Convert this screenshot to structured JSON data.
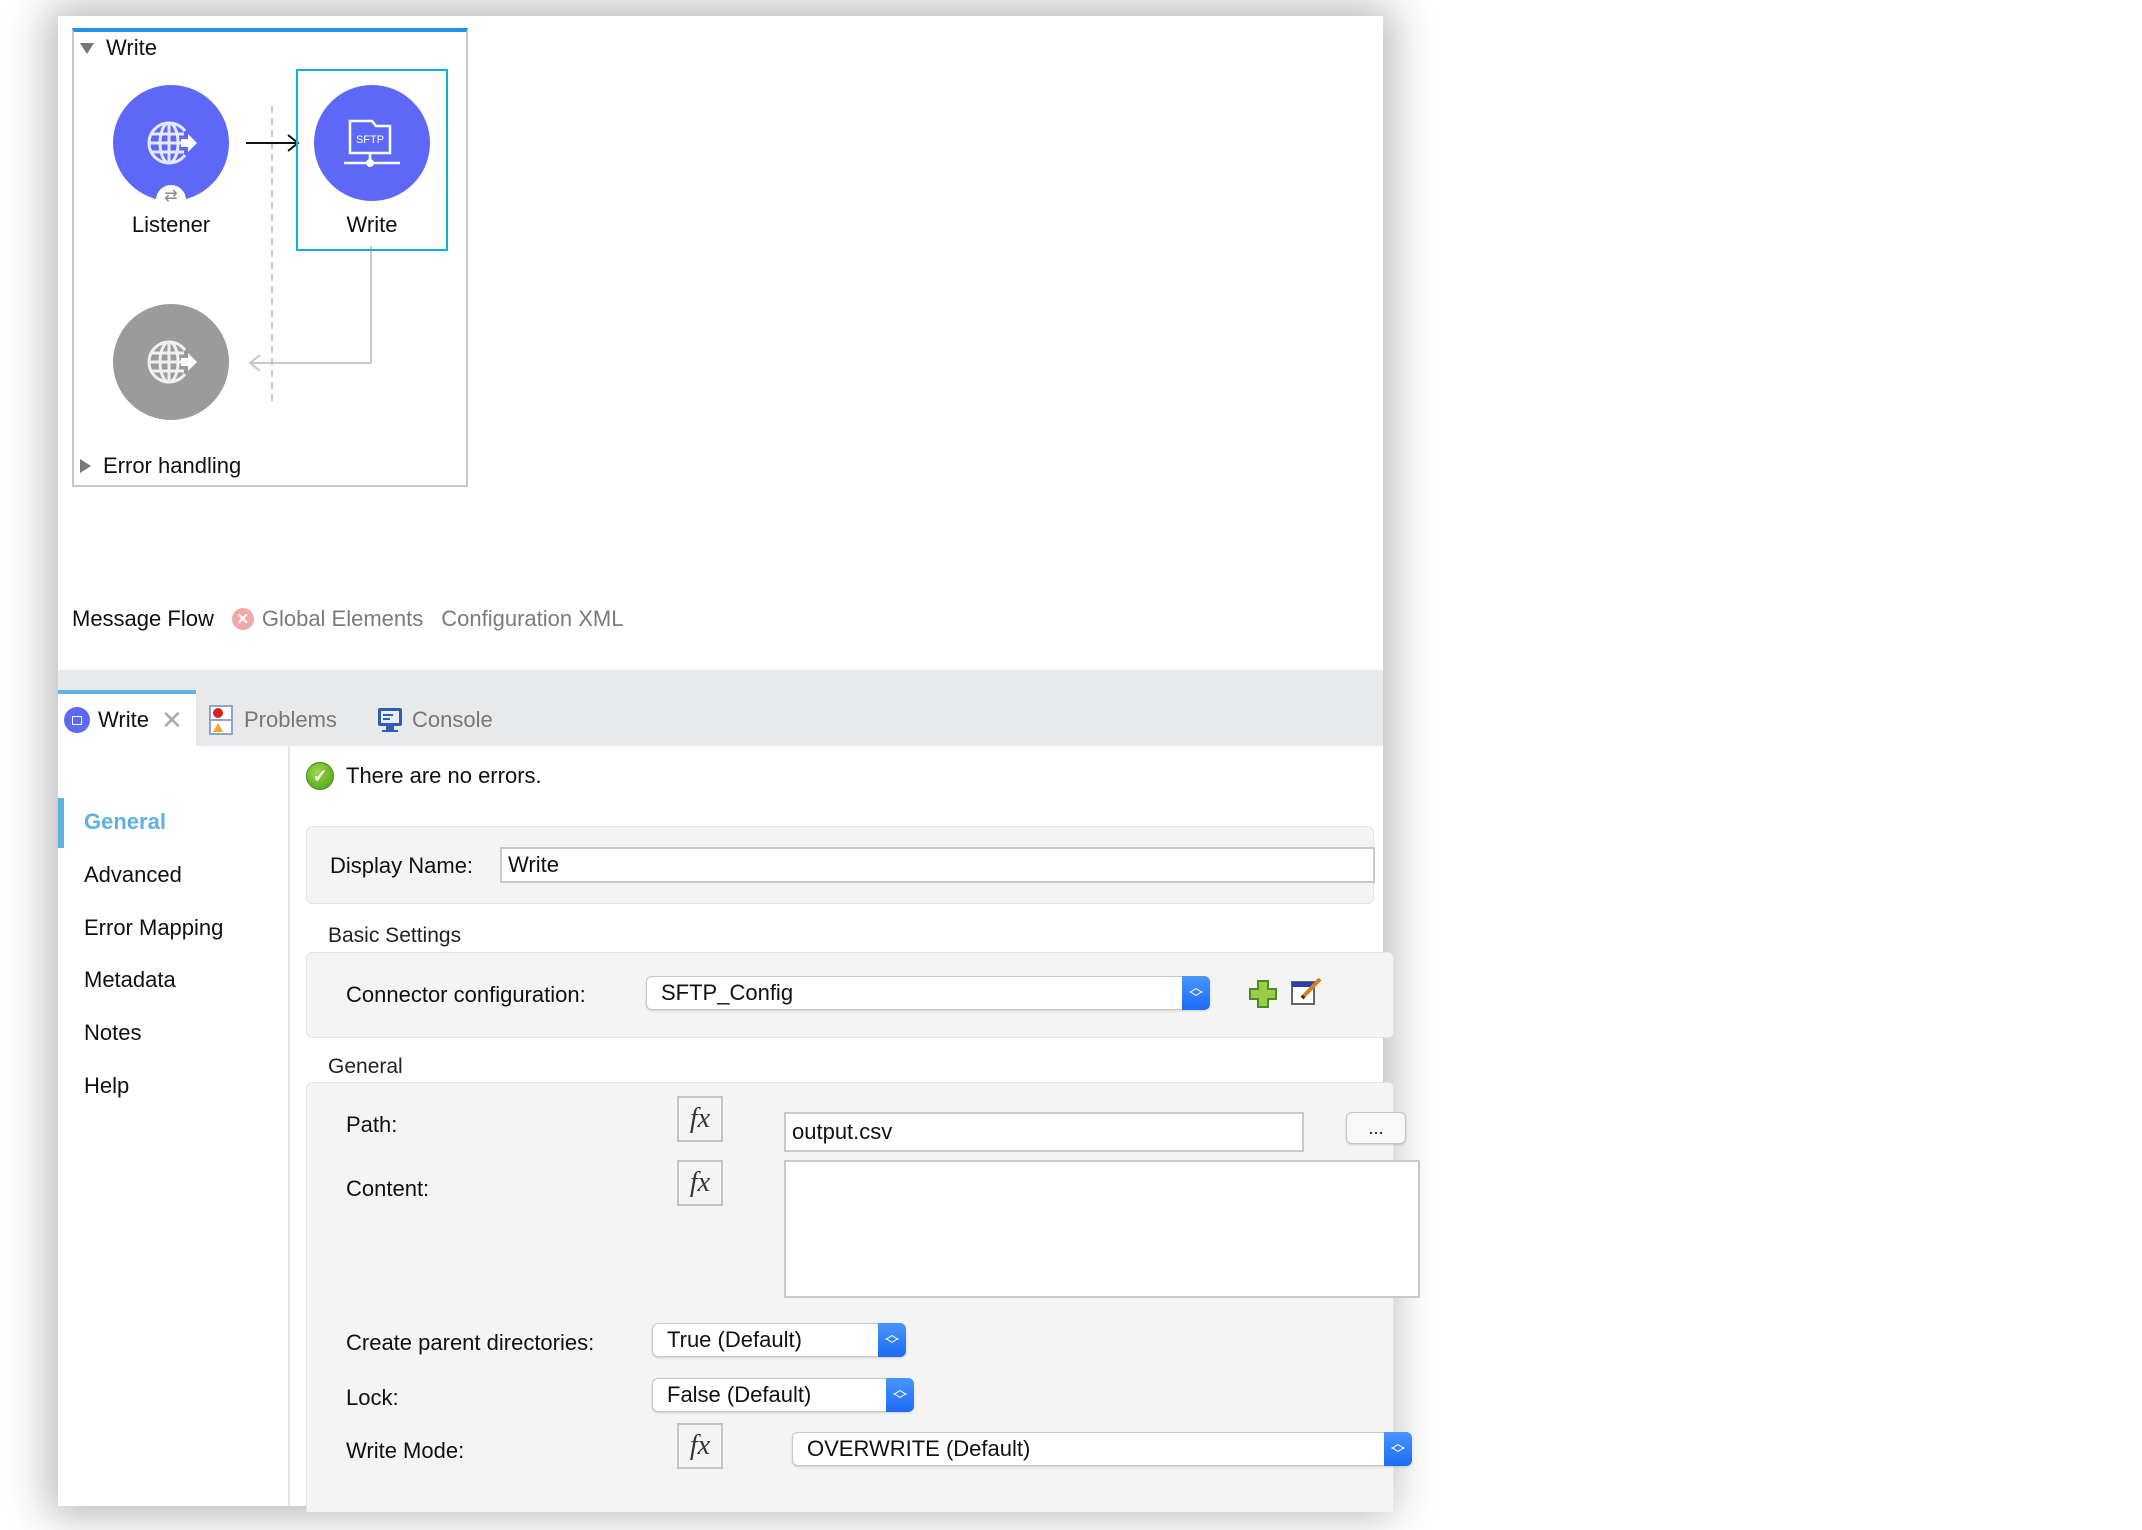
{
  "flow": {
    "title": "Write",
    "nodes": [
      {
        "label": "Listener",
        "icon": "http-listener-icon",
        "color": "#5d69f6"
      },
      {
        "label": "Write",
        "icon": "sftp-write-icon",
        "color": "#5d69f6",
        "icon_text": "SFTP",
        "selected": true
      },
      {
        "label": "",
        "icon": "http-response-icon",
        "color": "#9b9b9b"
      }
    ],
    "error_handling_label": "Error handling"
  },
  "editor_tabs": [
    {
      "label": "Message Flow",
      "active": true
    },
    {
      "label": "Global Elements",
      "has_error": true
    },
    {
      "label": "Configuration XML"
    }
  ],
  "panel_tabs": [
    {
      "label": "Write",
      "icon": "sftp-write-icon",
      "active": true,
      "closable": true
    },
    {
      "label": "Problems",
      "icon": "problems-icon"
    },
    {
      "label": "Console",
      "icon": "console-icon"
    }
  ],
  "nav": {
    "items": [
      {
        "label": "General",
        "active": true
      },
      {
        "label": "Advanced"
      },
      {
        "label": "Error Mapping"
      },
      {
        "label": "Metadata"
      },
      {
        "label": "Notes"
      },
      {
        "label": "Help"
      }
    ]
  },
  "form": {
    "status": "There are no errors.",
    "display_name_label": "Display Name:",
    "display_name_value": "Write",
    "basic_settings_title": "Basic Settings",
    "connector_config_label": "Connector configuration:",
    "connector_config_value": "SFTP_Config",
    "general_title": "General",
    "path_label": "Path:",
    "path_value": "output.csv",
    "browse_label": "...",
    "content_label": "Content:",
    "content_value": "",
    "create_parent_label": "Create parent directories:",
    "create_parent_value": "True (Default)",
    "lock_label": "Lock:",
    "lock_value": "False (Default)",
    "write_mode_label": "Write Mode:",
    "write_mode_value": "OVERWRITE (Default)",
    "fx_label": "fx"
  },
  "colors": {
    "accent": "#5fb2e0",
    "node_purple": "#5d69f6",
    "selection": "#11b1d4",
    "select_blue": "#1a6cf5"
  }
}
